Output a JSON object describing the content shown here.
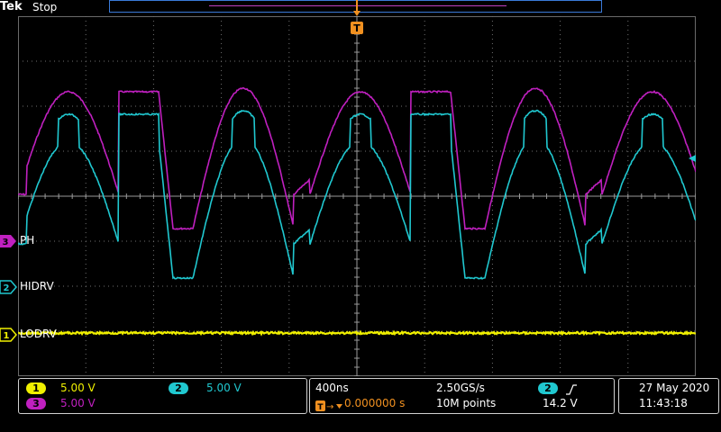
{
  "header": {
    "brand": "Tek",
    "acquisition_state": "Stop",
    "trigger_position_marker": "T"
  },
  "channels": [
    {
      "number": "3",
      "label": "PH",
      "color": "#c020c0"
    },
    {
      "number": "2",
      "label": "HIDRV",
      "color": "#20c8d0"
    },
    {
      "number": "1",
      "label": "LODRV",
      "color": "#f0f000"
    }
  ],
  "vertical_settings": {
    "ch1": {
      "number": "1",
      "scale": "5.00 V"
    },
    "ch2": {
      "number": "2",
      "scale": "5.00 V"
    },
    "ch3": {
      "number": "3",
      "scale": "5.00 V"
    }
  },
  "horizontal": {
    "timebase": "400ns",
    "sample_rate": "2.50GS/s",
    "trigger_delay": "0.000000 s",
    "record_length": "10M points"
  },
  "trigger": {
    "source": "2",
    "slope_icon": "rising-edge-icon",
    "level": "14.2 V"
  },
  "datetime": {
    "date": "27 May  2020",
    "time": "11:43:18"
  },
  "colors": {
    "ch1": "#f0f000",
    "ch2": "#20c8d0",
    "ch3": "#c020c0",
    "trigger": "#f09020"
  }
}
